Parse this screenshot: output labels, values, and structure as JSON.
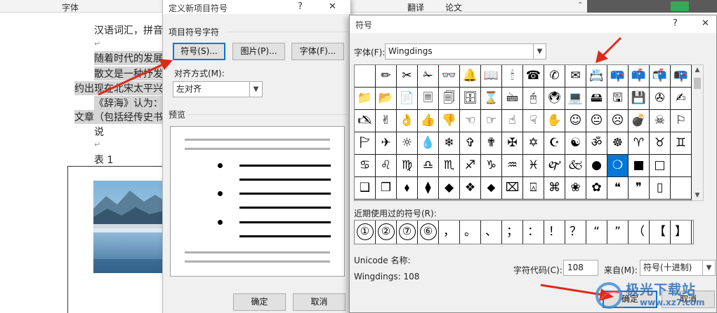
{
  "ribbon": {
    "font_tab": "字体",
    "translate": "翻译",
    "paper": "论文"
  },
  "document": {
    "lines": [
      "汉语词汇，拼音",
      "随着时代的发展",
      "散文是一种抒发",
      "约出现在北宋太平兴",
      "《辞海》认为：",
      "文章（包括经传史书",
      "说",
      "表 1"
    ]
  },
  "dialog1": {
    "title": "定义新项目符号",
    "help": "?",
    "close": "✕",
    "group_label": "项目符号字符",
    "symbol_button": "符号(S)...",
    "picture_button": "图片(P)...",
    "font_button": "字体(F)...",
    "align_label": "对齐方式(M):",
    "align_value": "左对齐",
    "preview_label": "预览",
    "ok": "确定",
    "cancel": "取消"
  },
  "dialog2": {
    "title": "符号",
    "help": "?",
    "close": "✕",
    "font_label": "字体(F):",
    "font_value": "Wingdings",
    "symbols": [
      " ",
      "✏",
      "✂",
      "✁",
      "👓",
      "🔔",
      "📖",
      "🕯",
      "☎",
      "✆",
      "✉",
      "📇",
      "📪",
      "📫",
      "📬",
      "📭",
      "📁",
      "📂",
      "📄",
      "🗏",
      "🗐",
      "🗄",
      "⌛",
      "🖮",
      "🖰",
      "🖲",
      "💻",
      "🖴",
      "🖫",
      "💾",
      "✇",
      "✍",
      "🖎",
      "✌",
      "👌",
      "👍",
      "👎",
      "☜",
      "☞",
      "☝",
      "☟",
      "✋",
      "☺",
      "😐",
      "☹",
      "💣",
      "☠",
      "⚐",
      "🏱",
      "✈",
      "☼",
      "💧",
      "❄",
      "✞",
      "✟",
      "✠",
      "✡",
      "☪",
      "☯",
      "ॐ",
      "☸",
      "♈",
      "♉",
      "♊",
      "♋",
      "♌",
      "♍",
      "♎",
      "♏",
      "♐",
      "♑",
      "♒",
      "♓",
      "🙰",
      "🙵",
      "●",
      "❍",
      "■",
      "□",
      "",
      "❑",
      "❒",
      "⬧",
      "⧫",
      "◆",
      "❖",
      "⬥",
      "⌧",
      "⍓",
      "⌘",
      "❀",
      "✿",
      "❝",
      "❞",
      "▯",
      ""
    ],
    "selected_index": 76,
    "recent_label": "近期使用过的符号(R):",
    "recent": [
      "①",
      "②",
      "⑦",
      "⑥",
      "，",
      "。",
      "、",
      "；",
      "：",
      "！",
      "？",
      "“",
      "”",
      "（",
      "【",
      "】"
    ],
    "unicode_name_label": "Unicode 名称:",
    "unicode_name_value": "Wingdings: 108",
    "char_code_label": "字符代码(C):",
    "char_code_value": "108",
    "from_label": "来自(M):",
    "from_value": "符号(十进制)",
    "ok": "确定",
    "cancel": "取消"
  },
  "watermark": {
    "brand": "极光下载站",
    "url": "www.xz7.com"
  },
  "colors": {
    "accent": "#0078d7",
    "arrow": "#e0281b",
    "highlight": "#d5d5d5"
  }
}
